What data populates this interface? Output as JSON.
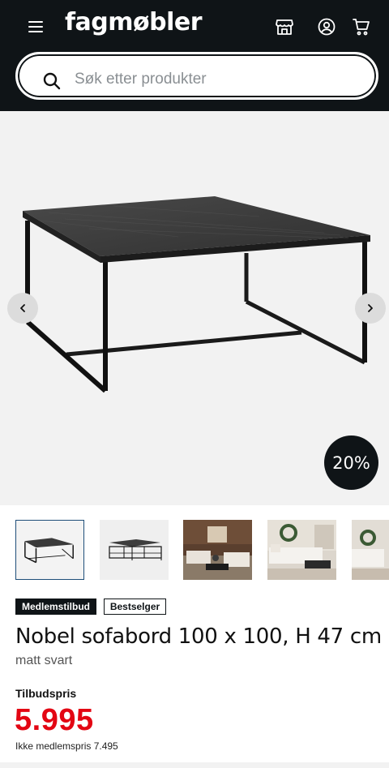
{
  "header": {
    "logo": "fagmøbler",
    "icons": [
      "menu-icon",
      "store-icon",
      "account-icon",
      "cart-icon"
    ],
    "background": "#0f1417"
  },
  "search": {
    "placeholder": "Søk etter produkter",
    "value": ""
  },
  "gallery": {
    "discount_badge": "20%",
    "thumbnail_count": 5,
    "active_thumbnail": 1
  },
  "badges": {
    "member": "Medlemstilbud",
    "bestseller": "Bestselger"
  },
  "product": {
    "title": "Nobel sofabord 100 x 100, H 47 cm",
    "variant": "matt svart",
    "offer_label": "Tilbudspris",
    "price": "5.995",
    "regular_price": "Ikke medlemspris 7.495"
  },
  "colors": {
    "accent_red": "#e30613",
    "dark": "#0f1417",
    "active_thumb_border": "#1f4e79"
  }
}
